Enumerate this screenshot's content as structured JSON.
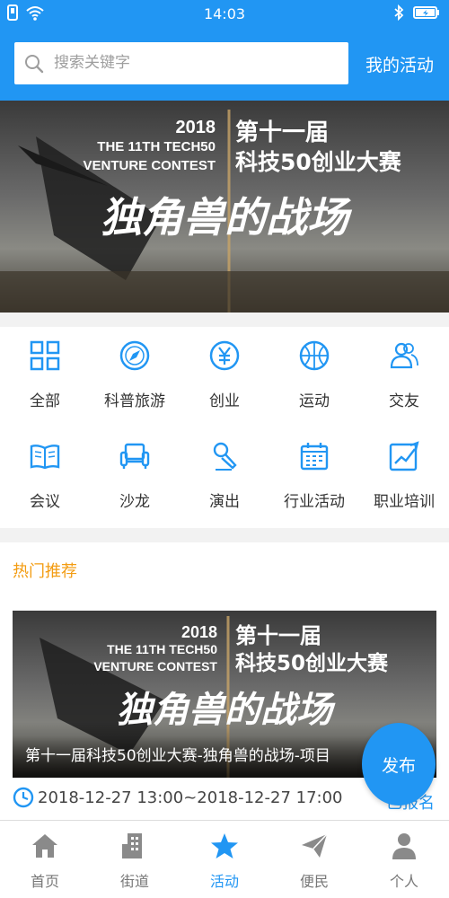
{
  "status_bar": {
    "time": "14:03"
  },
  "search": {
    "placeholder": "搜索关键字"
  },
  "header": {
    "my_activity_label": "我的活动"
  },
  "banner": {
    "year": "2018",
    "en_line1": "THE 11TH TECH50",
    "en_line2": "VENTURE CONTEST",
    "cn_line1": "第十一届",
    "cn_line2": "科技50创业大赛",
    "slogan": "独角兽的战场"
  },
  "categories": [
    {
      "label": "全部",
      "icon": "grid-icon"
    },
    {
      "label": "科普旅游",
      "icon": "compass-icon"
    },
    {
      "label": "创业",
      "icon": "yen-icon"
    },
    {
      "label": "运动",
      "icon": "basketball-icon"
    },
    {
      "label": "交友",
      "icon": "friends-icon"
    },
    {
      "label": "会议",
      "icon": "book-icon"
    },
    {
      "label": "沙龙",
      "icon": "sofa-icon"
    },
    {
      "label": "演出",
      "icon": "microphone-icon"
    },
    {
      "label": "行业活动",
      "icon": "calendar-icon"
    },
    {
      "label": "职业培训",
      "icon": "chart-icon"
    }
  ],
  "hot": {
    "title": "热门推荐",
    "card_caption": "第十一届科技50创业大赛-独角兽的战场-项目",
    "time_range": "2018-12-27 13:00~2018-12-27 17:00",
    "signup_label": "已报名"
  },
  "publish_label": "发布",
  "tabs": [
    {
      "label": "首页",
      "icon": "home-icon"
    },
    {
      "label": "街道",
      "icon": "building-icon"
    },
    {
      "label": "活动",
      "icon": "star-icon"
    },
    {
      "label": "便民",
      "icon": "send-icon"
    },
    {
      "label": "个人",
      "icon": "person-icon"
    }
  ],
  "colors": {
    "primary": "#2196f3",
    "hot_title": "#f39c12"
  }
}
